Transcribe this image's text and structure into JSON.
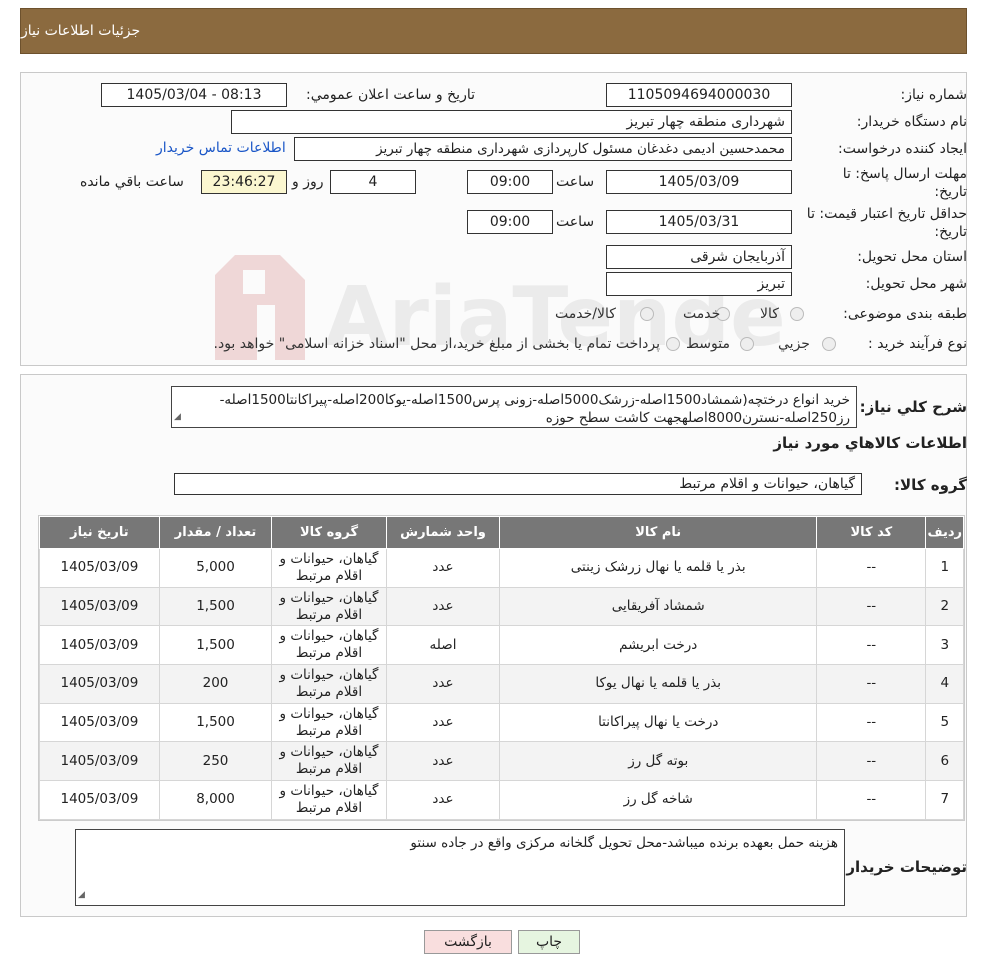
{
  "header": {
    "title": "جزئیات اطلاعات نیاز"
  },
  "form": {
    "need_number_label": "شماره نیاز:",
    "need_number": "1105094694000030",
    "announce_label": "تاریخ و ساعت اعلان عمومي:",
    "announce_value": "1405/03/04 - 08:13",
    "buyer_org_label": "نام دستگاه خریدار:",
    "buyer_org": "شهرداری منطقه چهار تبریز",
    "creator_label": "ایجاد کننده درخواست:",
    "creator": "محمدحسین ادیمی دغدغان مسئول کارپردازی شهرداری منطقه چهار تبریز",
    "contact_link": "اطلاعات تماس خریدار",
    "deadline_label_1": "مهلت ارسال پاسخ: تا",
    "deadline_label_2": "تاریخ:",
    "deadline_date": "1405/03/09",
    "time_label": "ساعت",
    "deadline_time": "09:00",
    "days_value": "4",
    "days_label": "روز و",
    "remaining_time": "23:46:27",
    "remaining_label": "ساعت باقي مانده",
    "validity_label_1": "حداقل تاریخ اعتبار قیمت: تا",
    "validity_label_2": "تاریخ:",
    "validity_date": "1405/03/31",
    "validity_time": "09:00",
    "province_label": "استان محل تحویل:",
    "province": "آذربایجان شرقی",
    "city_label": "شهر محل تحویل:",
    "city": "تبریز",
    "category_label": "طبقه بندی موضوعی:",
    "category_options": [
      "کالا",
      "خدمت",
      "کالا/خدمت"
    ],
    "process_label": "نوع فرآیند خرید :",
    "process_options": [
      "جزيي",
      "متوسط"
    ],
    "process_note": "پرداخت تمام یا بخشی از مبلغ خرید،از محل \"اسناد خزانه اسلامی\" خواهد بود."
  },
  "summary": {
    "label": "شرح كلي نياز:",
    "text": "خرید انواع درختچه(شمشاد1500اصله-زرشک5000اصله-زونی پرس1500اصله-یوکا200اصله-پیراکانتا1500اصله-رز250اصله-نسترن8000اصلهجهت کاشت سطح حوزه"
  },
  "goods": {
    "section_title": "اطلاعات كالاهاي مورد نياز",
    "group_label": "گروه كالا:",
    "group_value": "گیاهان، حیوانات و اقلام مرتبط"
  },
  "table": {
    "headers": [
      "رديف",
      "كد كالا",
      "نام كالا",
      "واحد شمارش",
      "گروه كالا",
      "تعداد / مقدار",
      "تاريخ نياز"
    ],
    "rows": [
      [
        "1",
        "--",
        "بذر یا قلمه یا نهال زرشک زینتی",
        "عدد",
        "گیاهان، حیوانات و اقلام مرتبط",
        "5,000",
        "1405/03/09"
      ],
      [
        "2",
        "--",
        "شمشاد آفریقایی",
        "عدد",
        "گیاهان، حیوانات و اقلام مرتبط",
        "1,500",
        "1405/03/09"
      ],
      [
        "3",
        "--",
        "درخت ابریشم",
        "اصله",
        "گیاهان، حیوانات و اقلام مرتبط",
        "1,500",
        "1405/03/09"
      ],
      [
        "4",
        "--",
        "بذر یا قلمه یا نهال یوکا",
        "عدد",
        "گیاهان، حیوانات و اقلام مرتبط",
        "200",
        "1405/03/09"
      ],
      [
        "5",
        "--",
        "درخت یا نهال پیراکانتا",
        "عدد",
        "گیاهان، حیوانات و اقلام مرتبط",
        "1,500",
        "1405/03/09"
      ],
      [
        "6",
        "--",
        "بوته گل رز",
        "عدد",
        "گیاهان، حیوانات و اقلام مرتبط",
        "250",
        "1405/03/09"
      ],
      [
        "7",
        "--",
        "شاخه گل رز",
        "عدد",
        "گیاهان، حیوانات و اقلام مرتبط",
        "8,000",
        "1405/03/09"
      ]
    ]
  },
  "buyer_notes": {
    "label": "توضیحات خریدار:",
    "text": "هزینه حمل بعهده برنده میباشد-محل تحویل گلخانه مرکزی واقع در جاده سنتو"
  },
  "buttons": {
    "print": "چاپ",
    "back": "بازگشت"
  },
  "watermark": {
    "text": "AriaTender.neT"
  },
  "colors": {
    "header": "#8b6a3f",
    "table_header": "#777777",
    "link": "#1a56c7",
    "timer_bg": "#fbf7d0",
    "back_bg": "#f9dede",
    "print_bg": "#e6f5e0"
  }
}
